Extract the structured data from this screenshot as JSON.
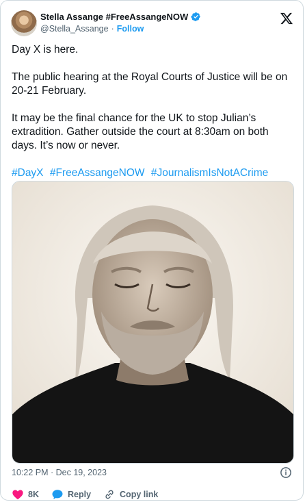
{
  "author": {
    "display_name": "Stella Assange #FreeAssangeNOW",
    "handle": "@Stella_Assange",
    "separator": "·",
    "follow_label": "Follow"
  },
  "tweet": {
    "paragraphs": [
      "Day X is here.",
      "The public hearing at the Royal Courts of Justice will be on 20-21 February.",
      "It may be the final chance for the UK to stop Julian’s extradition. Gather outside the court at 8:30am on both days. It’s now or never."
    ],
    "hashtags": [
      "#DayX",
      "#FreeAssangeNOW",
      "#JournalismIsNotACrime"
    ]
  },
  "timestamp": "10:22 PM · Dec 19, 2023",
  "actions": {
    "likes": "8K",
    "reply_label": "Reply",
    "copy_label": "Copy link"
  },
  "colors": {
    "accent": "#1d9bf0",
    "like": "#f91880",
    "muted": "#536471"
  },
  "icons": [
    "verified-badge-icon",
    "x-logo-icon",
    "info-icon",
    "heart-icon",
    "reply-bubble-icon",
    "link-icon"
  ]
}
